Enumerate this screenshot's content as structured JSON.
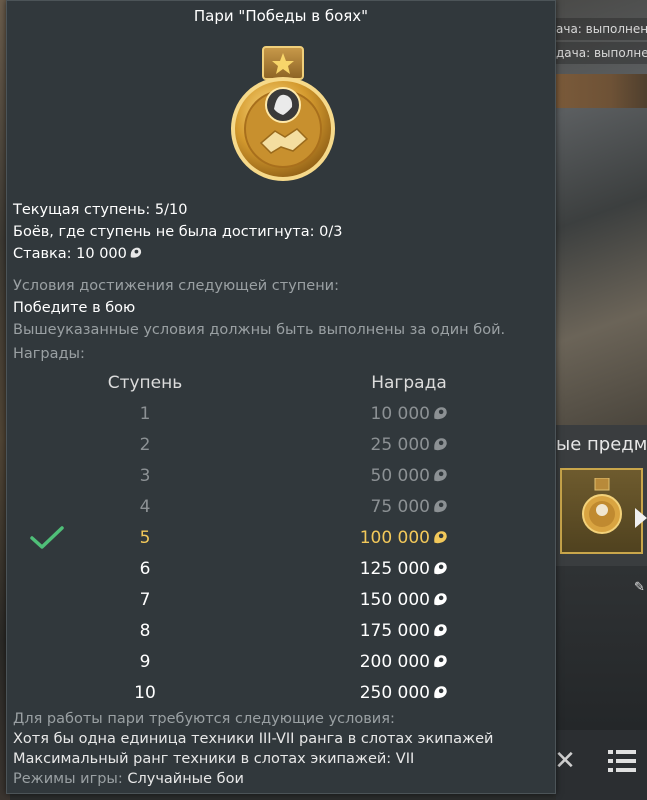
{
  "background": {
    "notifications": [
      "ача: выполнен",
      "дача: выполнен"
    ],
    "section_label": "ые предм"
  },
  "panel": {
    "title": "Пари \"Победы в боях\"",
    "current_step": "Текущая ступень: 5/10",
    "fails": "Боёв, где ступень не была достигнута: 0/3",
    "bet": "Ставка: 10 000",
    "conditions_header": "Условия достижения следующей ступени:",
    "condition": "Победите в бою",
    "condition_note": "Вышеуказанные условия должны быть выполнены за один бой.",
    "rewards_header": "Награды:",
    "table": {
      "col_step": "Ступень",
      "col_reward": "Награда",
      "rows": [
        {
          "step": "1",
          "reward": "10 000",
          "state": "past"
        },
        {
          "step": "2",
          "reward": "25 000",
          "state": "past"
        },
        {
          "step": "3",
          "reward": "50 000",
          "state": "past"
        },
        {
          "step": "4",
          "reward": "75 000",
          "state": "past"
        },
        {
          "step": "5",
          "reward": "100 000",
          "state": "current"
        },
        {
          "step": "6",
          "reward": "125 000",
          "state": "future"
        },
        {
          "step": "7",
          "reward": "150 000",
          "state": "future"
        },
        {
          "step": "8",
          "reward": "175 000",
          "state": "future"
        },
        {
          "step": "9",
          "reward": "200 000",
          "state": "future"
        },
        {
          "step": "10",
          "reward": "250 000",
          "state": "future"
        }
      ]
    },
    "requirements_header": "Для работы пари требуются следующие условия:",
    "req1": "Хотя бы одна единица техники III-VII ранга в слотах экипажей",
    "req2": "Максимальный ранг техники в слотах экипажей: VII",
    "req3_label": "Режимы игры: ",
    "req3_value": "Случайные бои"
  },
  "colors": {
    "panel_bg": "#31383c",
    "past": "#8c9194",
    "current": "#f2c85a",
    "future": "#ffffff",
    "check": "#4fbf78"
  },
  "icons": [
    "coin-icon",
    "check-icon",
    "medal-icon",
    "close-icon",
    "list-icon",
    "pen-icon"
  ]
}
